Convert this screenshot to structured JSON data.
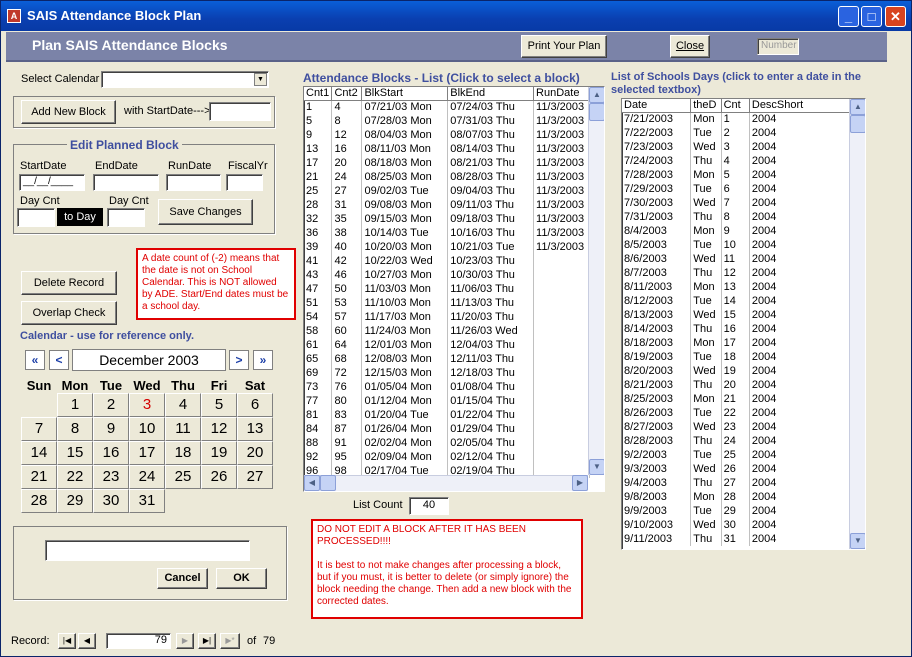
{
  "window": {
    "title": "SAIS Attendance Block Plan",
    "icon_letter": "A",
    "min": "_",
    "max": "□",
    "close": "✕"
  },
  "header": {
    "title": "Plan SAIS Attendance Blocks",
    "print_label": "Print Your Plan",
    "close_label": "Close",
    "number_placeholder": "Number"
  },
  "left": {
    "select_calendar_label": "Select Calendar",
    "add_new_block_label": "Add New Block",
    "with_start_label": "with StartDate--->",
    "edit_title": "Edit Planned Block",
    "start_date_label": "StartDate",
    "end_date_label": "EndDate",
    "run_date_label": "RunDate",
    "fiscal_yr_label": "FiscalYr",
    "start_date_value": "__/__/____",
    "day_cnt_label": "Day Cnt",
    "to_day_label": "to Day",
    "day_cnt2_label": "Day Cnt",
    "save_changes_label": "Save Changes",
    "delete_record_label": "Delete Record",
    "overlap_check_label": "Overlap Check",
    "warning_text": "A date count of (-2) means that the date is not on School Calendar.  This is NOT allowed by ADE.  Start/End dates must be a school day.",
    "calendar_title": "Calendar - use for reference only.",
    "cancel_label": "Cancel",
    "ok_label": "OK"
  },
  "calendar": {
    "month": "December 2003",
    "first_label": "«",
    "prev_label": "<",
    "next_label": ">",
    "last_label": "»",
    "days": [
      "Sun",
      "Mon",
      "Tue",
      "Wed",
      "Thu",
      "Fri",
      "Sat"
    ],
    "today": 3,
    "highlight_color": "#d40000",
    "weeks": [
      [
        "",
        "1",
        "2",
        "3",
        "4",
        "5",
        "6"
      ],
      [
        "7",
        "8",
        "9",
        "10",
        "11",
        "12",
        "13"
      ],
      [
        "14",
        "15",
        "16",
        "17",
        "18",
        "19",
        "20"
      ],
      [
        "21",
        "22",
        "23",
        "24",
        "25",
        "26",
        "27"
      ],
      [
        "28",
        "29",
        "30",
        "31",
        "",
        "",
        ""
      ]
    ]
  },
  "blocks": {
    "title": "Attendance Blocks - List (Click to select a block)",
    "columns": [
      "Cnt1",
      "Cnt2",
      "BlkStart",
      "BlkEnd",
      "RunDate"
    ],
    "rows": [
      [
        "1",
        "4",
        "07/21/03 Mon",
        "07/24/03 Thu",
        "11/3/2003"
      ],
      [
        "5",
        "8",
        "07/28/03 Mon",
        "07/31/03 Thu",
        "11/3/2003"
      ],
      [
        "9",
        "12",
        "08/04/03 Mon",
        "08/07/03 Thu",
        "11/3/2003"
      ],
      [
        "13",
        "16",
        "08/11/03 Mon",
        "08/14/03 Thu",
        "11/3/2003"
      ],
      [
        "17",
        "20",
        "08/18/03 Mon",
        "08/21/03 Thu",
        "11/3/2003"
      ],
      [
        "21",
        "24",
        "08/25/03 Mon",
        "08/28/03 Thu",
        "11/3/2003"
      ],
      [
        "25",
        "27",
        "09/02/03 Tue",
        "09/04/03 Thu",
        "11/3/2003"
      ],
      [
        "28",
        "31",
        "09/08/03 Mon",
        "09/11/03 Thu",
        "11/3/2003"
      ],
      [
        "32",
        "35",
        "09/15/03 Mon",
        "09/18/03 Thu",
        "11/3/2003"
      ],
      [
        "36",
        "38",
        "10/14/03 Tue",
        "10/16/03 Thu",
        "11/3/2003"
      ],
      [
        "39",
        "40",
        "10/20/03 Mon",
        "10/21/03 Tue",
        "11/3/2003"
      ],
      [
        "41",
        "42",
        "10/22/03 Wed",
        "10/23/03 Thu",
        ""
      ],
      [
        "43",
        "46",
        "10/27/03 Mon",
        "10/30/03 Thu",
        ""
      ],
      [
        "47",
        "50",
        "11/03/03 Mon",
        "11/06/03 Thu",
        ""
      ],
      [
        "51",
        "53",
        "11/10/03 Mon",
        "11/13/03 Thu",
        ""
      ],
      [
        "54",
        "57",
        "11/17/03 Mon",
        "11/20/03 Thu",
        ""
      ],
      [
        "58",
        "60",
        "11/24/03 Mon",
        "11/26/03 Wed",
        ""
      ],
      [
        "61",
        "64",
        "12/01/03 Mon",
        "12/04/03 Thu",
        ""
      ],
      [
        "65",
        "68",
        "12/08/03 Mon",
        "12/11/03 Thu",
        ""
      ],
      [
        "69",
        "72",
        "12/15/03 Mon",
        "12/18/03 Thu",
        ""
      ],
      [
        "73",
        "76",
        "01/05/04 Mon",
        "01/08/04 Thu",
        ""
      ],
      [
        "77",
        "80",
        "01/12/04 Mon",
        "01/15/04 Thu",
        ""
      ],
      [
        "81",
        "83",
        "01/20/04 Tue",
        "01/22/04 Thu",
        ""
      ],
      [
        "84",
        "87",
        "01/26/04 Mon",
        "01/29/04 Thu",
        ""
      ],
      [
        "88",
        "91",
        "02/02/04 Mon",
        "02/05/04 Thu",
        ""
      ],
      [
        "92",
        "95",
        "02/09/04 Mon",
        "02/12/04 Thu",
        ""
      ],
      [
        "96",
        "98",
        "02/17/04 Tue",
        "02/19/04 Thu",
        ""
      ]
    ],
    "list_count_label": "List Count",
    "list_count_value": "40"
  },
  "notice_text_1": "DO NOT EDIT A BLOCK AFTER IT HAS BEEN PROCESSED!!!!",
  "notice_text_2": "It is best to not make changes after processing a block, but if you must, it is better to delete (or simply ignore) the block needing the change.  Then add a new block with the corrected dates.",
  "days_list": {
    "title": "List of Schools Days (click to enter a date in the selected textbox)",
    "columns": [
      "Date",
      "theD",
      "Cnt",
      "DescShort"
    ],
    "rows": [
      [
        "7/21/2003",
        "Mon",
        "1",
        "2004"
      ],
      [
        "7/22/2003",
        "Tue",
        "2",
        "2004"
      ],
      [
        "7/23/2003",
        "Wed",
        "3",
        "2004"
      ],
      [
        "7/24/2003",
        "Thu",
        "4",
        "2004"
      ],
      [
        "7/28/2003",
        "Mon",
        "5",
        "2004"
      ],
      [
        "7/29/2003",
        "Tue",
        "6",
        "2004"
      ],
      [
        "7/30/2003",
        "Wed",
        "7",
        "2004"
      ],
      [
        "7/31/2003",
        "Thu",
        "8",
        "2004"
      ],
      [
        "8/4/2003",
        "Mon",
        "9",
        "2004"
      ],
      [
        "8/5/2003",
        "Tue",
        "10",
        "2004"
      ],
      [
        "8/6/2003",
        "Wed",
        "11",
        "2004"
      ],
      [
        "8/7/2003",
        "Thu",
        "12",
        "2004"
      ],
      [
        "8/11/2003",
        "Mon",
        "13",
        "2004"
      ],
      [
        "8/12/2003",
        "Tue",
        "14",
        "2004"
      ],
      [
        "8/13/2003",
        "Wed",
        "15",
        "2004"
      ],
      [
        "8/14/2003",
        "Thu",
        "16",
        "2004"
      ],
      [
        "8/18/2003",
        "Mon",
        "17",
        "2004"
      ],
      [
        "8/19/2003",
        "Tue",
        "18",
        "2004"
      ],
      [
        "8/20/2003",
        "Wed",
        "19",
        "2004"
      ],
      [
        "8/21/2003",
        "Thu",
        "20",
        "2004"
      ],
      [
        "8/25/2003",
        "Mon",
        "21",
        "2004"
      ],
      [
        "8/26/2003",
        "Tue",
        "22",
        "2004"
      ],
      [
        "8/27/2003",
        "Wed",
        "23",
        "2004"
      ],
      [
        "8/28/2003",
        "Thu",
        "24",
        "2004"
      ],
      [
        "9/2/2003",
        "Tue",
        "25",
        "2004"
      ],
      [
        "9/3/2003",
        "Wed",
        "26",
        "2004"
      ],
      [
        "9/4/2003",
        "Thu",
        "27",
        "2004"
      ],
      [
        "9/8/2003",
        "Mon",
        "28",
        "2004"
      ],
      [
        "9/9/2003",
        "Tue",
        "29",
        "2004"
      ],
      [
        "9/10/2003",
        "Wed",
        "30",
        "2004"
      ],
      [
        "9/11/2003",
        "Thu",
        "31",
        "2004"
      ]
    ]
  },
  "record_nav": {
    "label": "Record:",
    "first": "|◀",
    "prev": "◀",
    "current": "79",
    "next": "▶",
    "last": "▶|",
    "new": "▶*",
    "of_label": "of",
    "total": "79"
  }
}
